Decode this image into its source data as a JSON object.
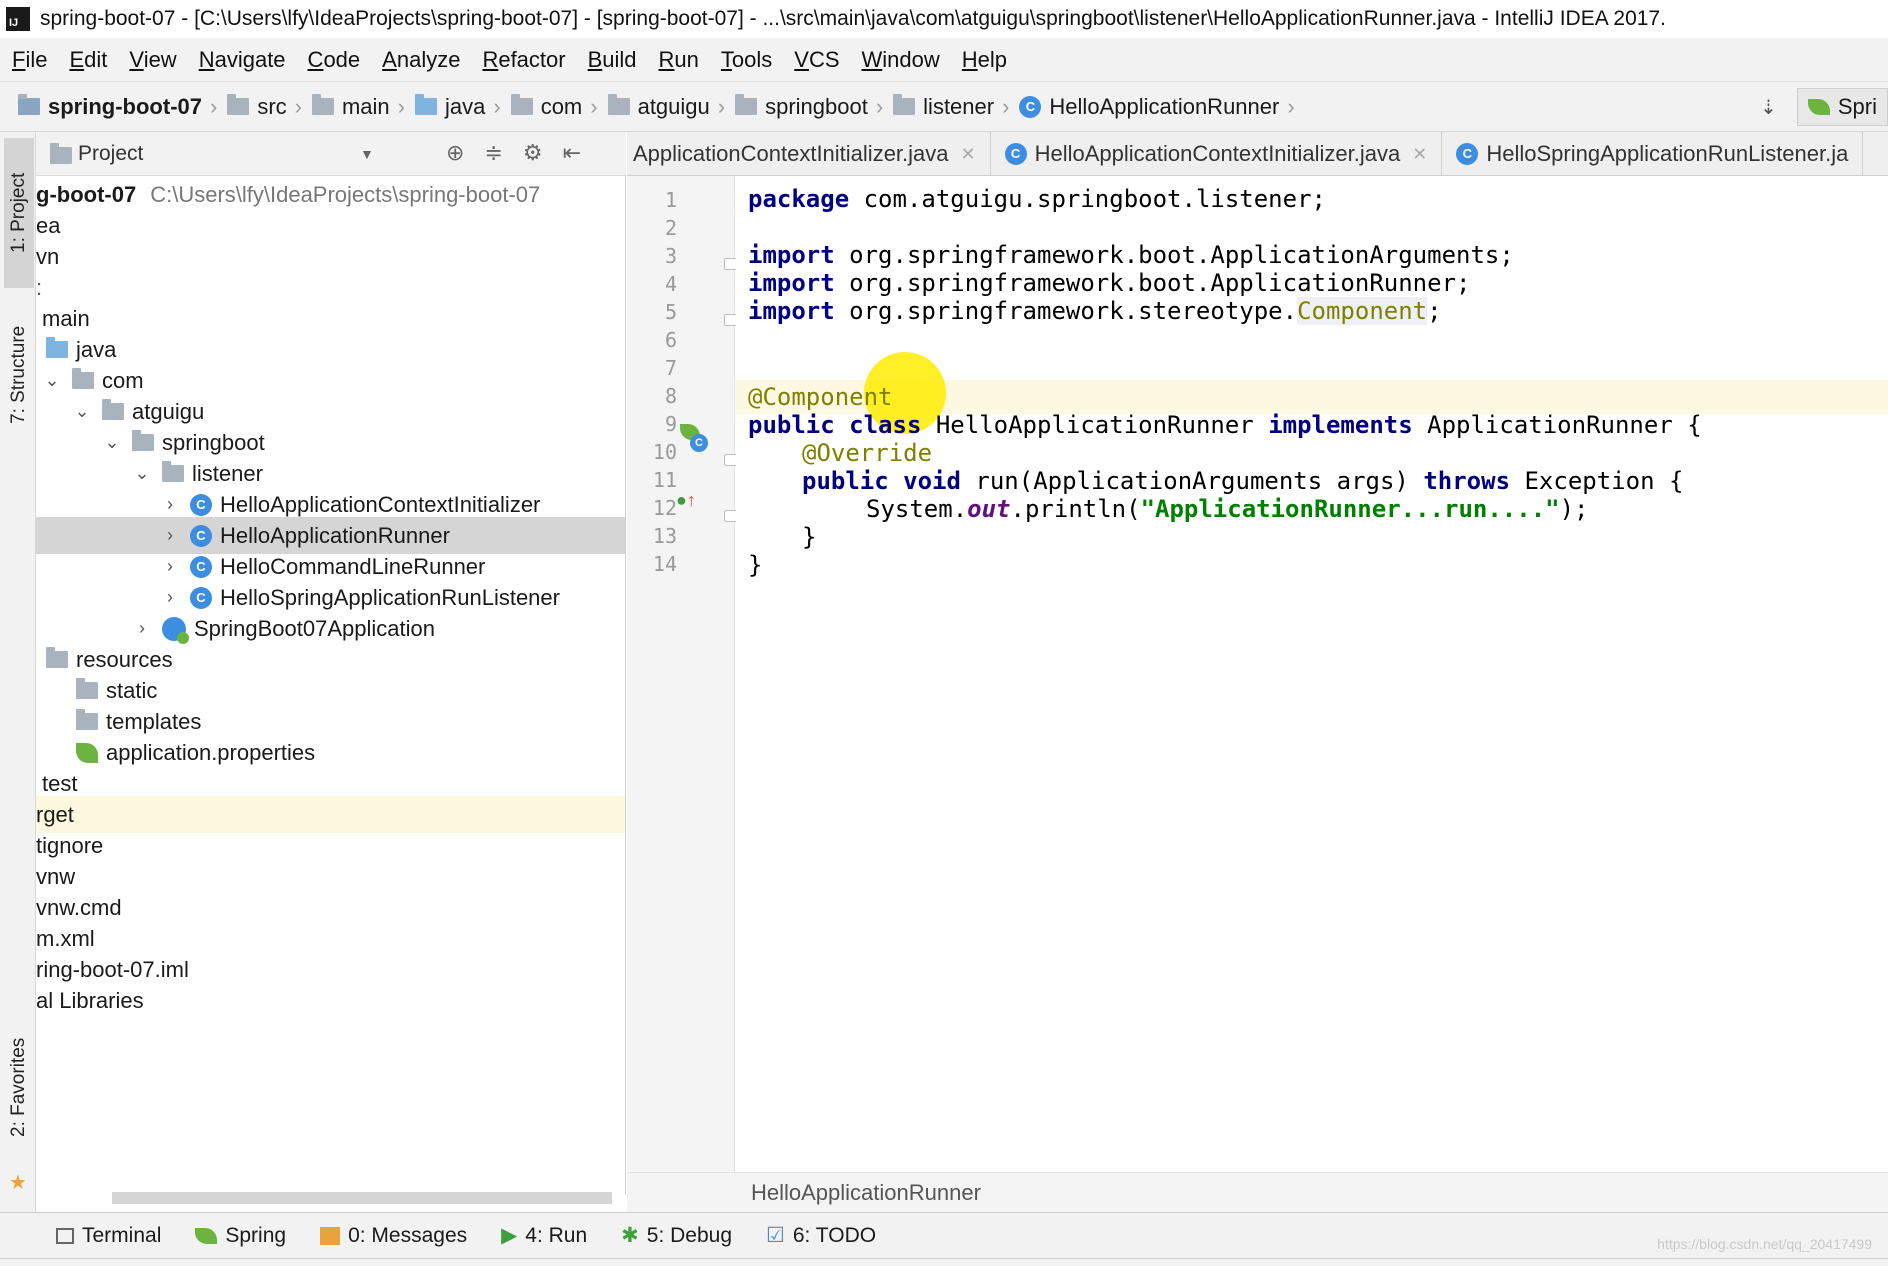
{
  "titlebar": {
    "title": "spring-boot-07 - [C:\\Users\\lfy\\IdeaProjects\\spring-boot-07] - [spring-boot-07] - ...\\src\\main\\java\\com\\atguigu\\springboot\\listener\\HelloApplicationRunner.java - IntelliJ IDEA 2017."
  },
  "menu": [
    "File",
    "Edit",
    "View",
    "Navigate",
    "Code",
    "Analyze",
    "Refactor",
    "Build",
    "Run",
    "Tools",
    "VCS",
    "Window",
    "Help"
  ],
  "breadcrumb": [
    "spring-boot-07",
    "src",
    "main",
    "java",
    "com",
    "atguigu",
    "springboot",
    "listener",
    "HelloApplicationRunner"
  ],
  "run_config": "Spri",
  "left_strip": {
    "project": "1: Project",
    "structure": "7: Structure",
    "favorites": "2: Favorites"
  },
  "project_panel": {
    "title": "Project",
    "root_name": "g-boot-07",
    "root_path": "C:\\Users\\lfy\\IdeaProjects\\spring-boot-07",
    "rows": [
      "ea",
      "vn",
      "main",
      "java",
      "com",
      "atguigu",
      "springboot",
      "listener",
      "HelloApplicationContextInitializer",
      "HelloApplicationRunner",
      "HelloCommandLineRunner",
      "HelloSpringApplicationRunListener",
      "SpringBoot07Application",
      "resources",
      "static",
      "templates",
      "application.properties",
      "test",
      "rget",
      "tignore",
      "vnw",
      "vnw.cmd",
      "m.xml",
      "ring-boot-07.iml",
      "al Libraries"
    ]
  },
  "tabs": [
    "ApplicationContextInitializer.java",
    "HelloApplicationContextInitializer.java",
    "HelloSpringApplicationRunListener.ja"
  ],
  "code": {
    "line_numbers": [
      "1",
      "2",
      "3",
      "4",
      "5",
      "6",
      "7",
      "8",
      "9",
      "10",
      "11",
      "12",
      "13",
      "14"
    ],
    "l1_kw": "package",
    "l1_rest": " com.atguigu.springboot.listener;",
    "l3_kw": "import",
    "l3_rest": " org.springframework.boot.ApplicationArguments;",
    "l4_kw": "import",
    "l4_rest": " org.springframework.boot.ApplicationRunner;",
    "l5_kw": "import",
    "l5_rest": " org.springframework.stereotype.",
    "l5_comp": "Component",
    "l5_end": ";",
    "l7_anno": "@Component",
    "l8_kw1": "public",
    "l8_kw2": " class",
    "l8_name": " HelloApplicationRunner ",
    "l8_kw3": "implements",
    "l8_rest": " ApplicationRunner {",
    "l9_anno": "@Override",
    "l10_kw1": "public",
    "l10_kw2": " void",
    "l10_mid": " run(ApplicationArguments args) ",
    "l10_kw3": "throws",
    "l10_rest": " Exception {",
    "l11_a": "System.",
    "l11_out": "out",
    "l11_b": ".println(",
    "l11_str": "\"ApplicationRunner...run....\"",
    "l11_c": ");",
    "l12": "}",
    "l13": "}"
  },
  "editor_breadcrumb": "HelloApplicationRunner",
  "bottom_tools": {
    "terminal": "Terminal",
    "spring": "Spring",
    "messages": "0: Messages",
    "run": "4: Run",
    "debug": "5: Debug",
    "todo": "6: TODO"
  },
  "watermark": "https://blog.csdn.net/qq_20417499",
  "colors": {
    "keyword": "#000080",
    "annotation": "#808000",
    "string": "#008000",
    "selection": "#d5d5d5"
  }
}
